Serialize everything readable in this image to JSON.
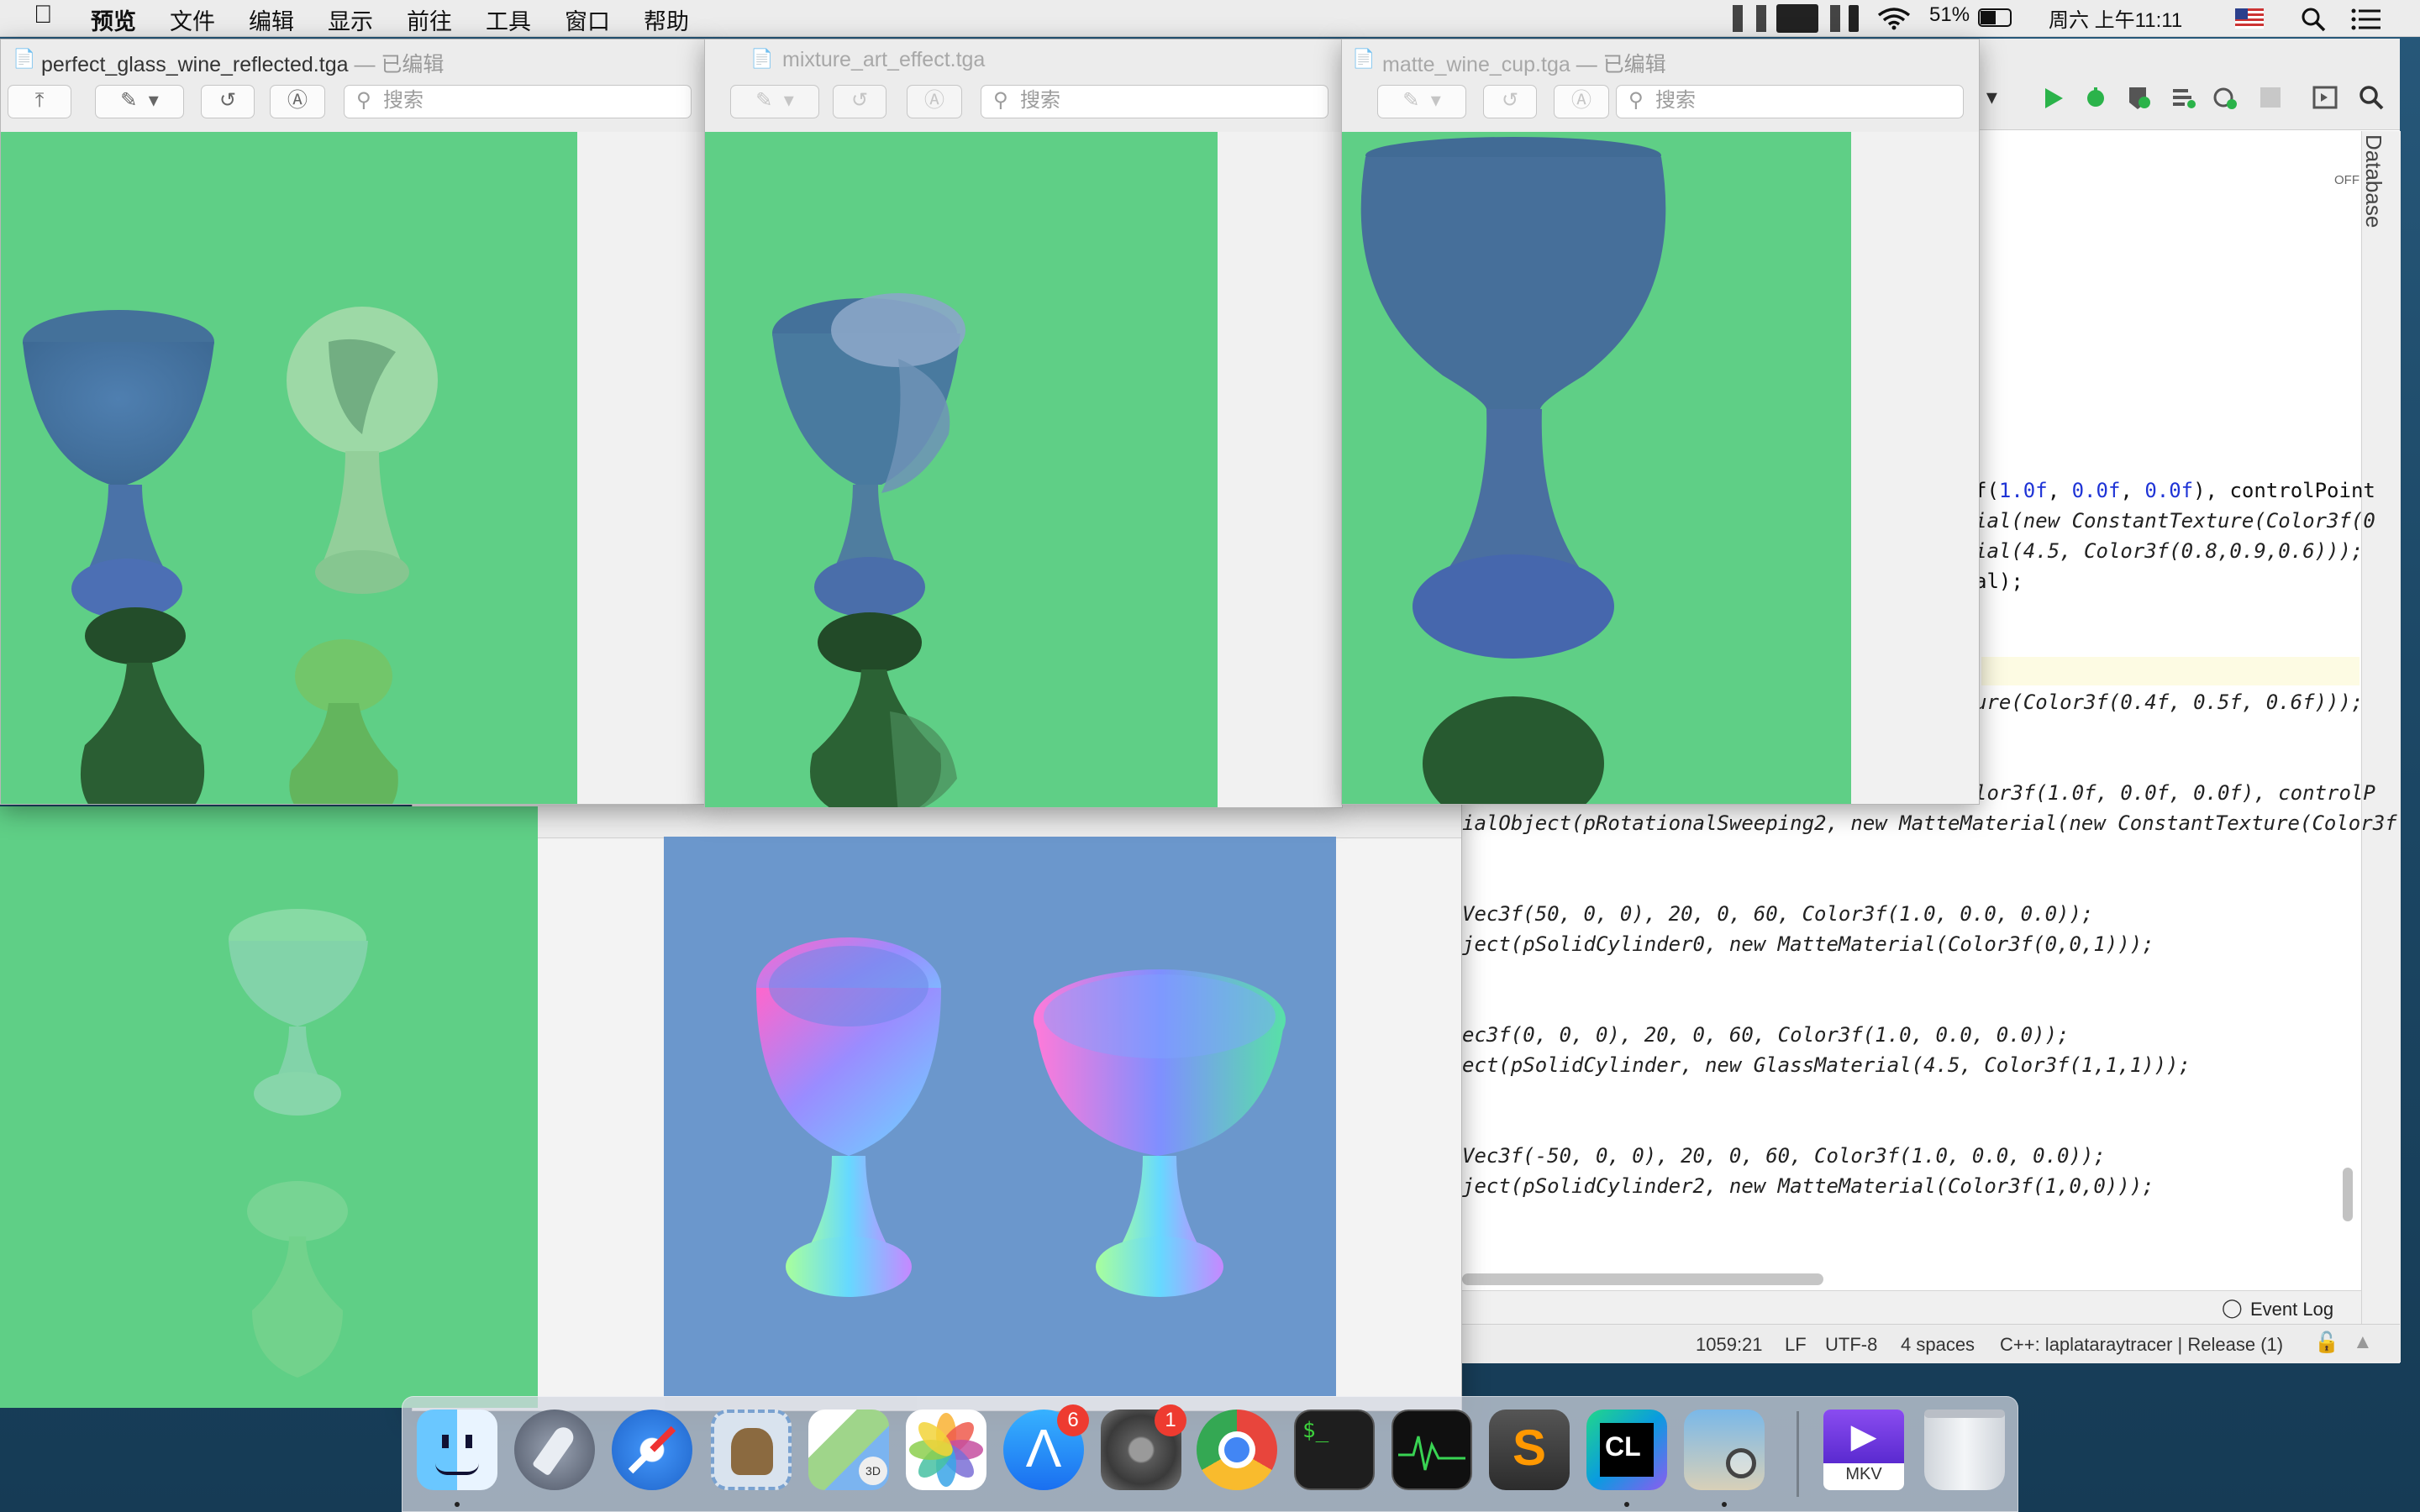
{
  "menubar": {
    "items": [
      "预览",
      "文件",
      "编辑",
      "显示",
      "前往",
      "工具",
      "窗口",
      "帮助"
    ],
    "battery": "51%",
    "clock": "周六 上午11:11"
  },
  "windows": {
    "w1": {
      "filename": "perfect_glass_wine_reflected.tga",
      "edited": " — 已编辑"
    },
    "w2": {
      "filename": "mixture_art_effect.tga",
      "edited": ""
    },
    "w3": {
      "filename": "matte_wine_cup.tga",
      "edited": " — 已编辑"
    },
    "search_placeholder": "搜索"
  },
  "ide": {
    "database_tab": "Database",
    "off_label": "OFF",
    "code_lines": [
      "f(1.0f, 0.0f, 0.0f), controlPoint",
      "ial(new ConstantTexture(Color3f(0",
      "ial(4.5, Color3f(0.8,0.9,0.6)));",
      "al);",
      "ure(Color3f(0.4f, 0.5f, 0.6f)));",
      "lor3f(1.0f, 0.0f, 0.0f), controlP",
      "ialObject(pRotationalSweeping2, new MatteMaterial(new ConstantTexture(Color3f",
      "Vec3f(50, 0, 0), 20, 0, 60, Color3f(1.0, 0.0, 0.0));",
      "ject(pSolidCylinder0, new MatteMaterial(Color3f(0,0,1)));",
      "ec3f(0, 0, 0), 20, 0, 60, Color3f(1.0, 0.0, 0.0));",
      "ect(pSolidCylinder, new GlassMaterial(4.5, Color3f(1,1,1)));",
      "Vec3f(-50, 0, 0), 20, 0, 60, Color3f(1.0, 0.0, 0.0));",
      "ject(pSolidCylinder2, new MatteMaterial(Color3f(1,0,0)));"
    ],
    "event_log": "Event Log",
    "status": {
      "position": "1059:21",
      "line_sep": "LF",
      "encoding": "UTF-8",
      "indent": "4 spaces",
      "context": "C++: laplataraytracer | Release (1)"
    }
  },
  "dock": {
    "items": [
      "finder-icon",
      "launchpad-icon",
      "safari-icon",
      "mail-icon",
      "maps-icon",
      "photos-icon",
      "app-store-icon",
      "system-preferences-icon",
      "chrome-icon",
      "terminal-icon",
      "activity-monitor-icon",
      "sublime-text-icon",
      "clion-icon",
      "preview-icon",
      "mkv-player-icon",
      "trash-icon"
    ],
    "app_store_badge": "6",
    "prefs_badge": "1",
    "mkv_label": "MKV"
  },
  "colors": {
    "canvas_green": "#5fcf86",
    "canvas_blue": "#6b97cc",
    "menubar": "#ececec"
  }
}
